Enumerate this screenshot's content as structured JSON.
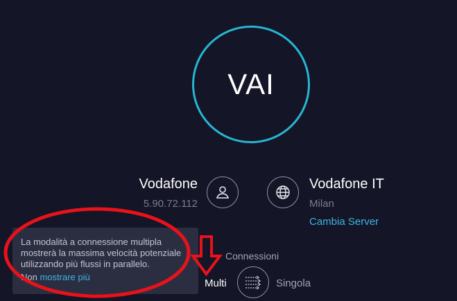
{
  "go_button": {
    "label": "VAI"
  },
  "isp": {
    "name": "Vodafone",
    "ip": "5.90.72.112",
    "icon": "user-icon"
  },
  "server": {
    "name": "Vodafone IT",
    "city": "Milan",
    "change_label": "Cambia Server",
    "icon": "globe-icon"
  },
  "connections": {
    "title": "Connessioni",
    "multi_label": "Multi",
    "single_label": "Singola",
    "selected": "Multi",
    "icon": "connections-toggle-icon"
  },
  "tooltip": {
    "text": "La modalità a connessione multipla mostrerà la massima velocità potenziale utilizzando più flussi in parallelo.",
    "link_prefix": "Non ",
    "link_label": "mostrare più"
  },
  "annotations": {
    "ellipse_color": "#e8121b",
    "arrow_color": "#e8121b"
  },
  "colors": {
    "background": "#141526",
    "accent": "#27b6d2",
    "link": "#3fb4e8"
  }
}
